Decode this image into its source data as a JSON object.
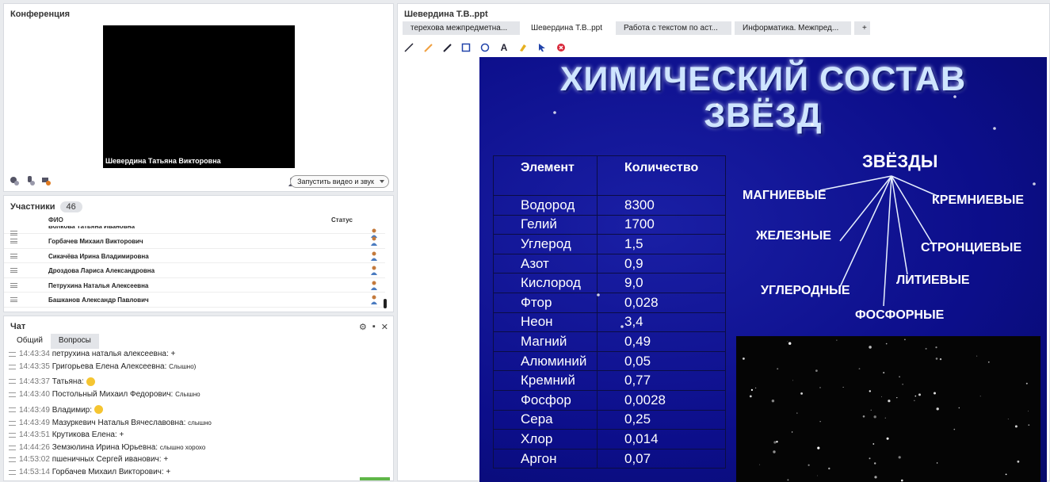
{
  "conference": {
    "title": "Конференция",
    "video_name": "Шевердина Татьяна Викторовна",
    "start_video_label": "Запустить видео и звук"
  },
  "participants": {
    "title": "Участники",
    "count": "46",
    "col_name": "ФИО",
    "col_status": "Статус",
    "rows": [
      "Волкова Татьяна Ивановна",
      "Горбачев Михаил  Викторович",
      "Сикачёва Ирина  Владимировна",
      "Дроздова Лариса  Александровна",
      "Петрухина  Наталья  Алексеевна",
      "Башканов Александр Павлович"
    ]
  },
  "chat": {
    "title": "Чат",
    "tabs": [
      "Общий",
      "Вопросы"
    ],
    "messages": [
      {
        "time": "14:43:34",
        "author": "петрухина  наталья алексеевна:",
        "text": "+",
        "small": false
      },
      {
        "time": "14:43:35",
        "author": "Григорьева Елена  Алексеевна:",
        "text": "Слышно)",
        "small": true
      },
      {
        "time": "14:43:37",
        "author": "Татьяна:",
        "text": "",
        "emoji": true
      },
      {
        "time": "14:43:40",
        "author": "Постольный Михаил  Федорович:",
        "text": "Слышно",
        "small": true
      },
      {
        "time": "14:43:49",
        "author": "Владимир:",
        "text": "",
        "emoji": true
      },
      {
        "time": "14:43:49",
        "author": "Мазуркевич Наталья  Вячеславовна:",
        "text": "слышно",
        "small": true
      },
      {
        "time": "14:43:51",
        "author": "Крутикова Елена:",
        "text": "+",
        "small": false
      },
      {
        "time": "14:44:26",
        "author": "Земзюлина  Ирина   Юрьевна:",
        "text": "слышно хорохо",
        "small": true
      },
      {
        "time": "14:53:02",
        "author": "пшеничных  Сергей иванович:",
        "text": "+",
        "small": false
      },
      {
        "time": "14:53:14",
        "author": "Горбачев Михаил  Викторович:",
        "text": "+",
        "small": false
      }
    ]
  },
  "presentation": {
    "title": "Шевердина Т.В..ppt",
    "tabs": [
      "терехова межпредметна...",
      "Шевердина Т.В..ppt",
      "Работа с текстом по аст...",
      "Информатика. Межпред...",
      "+"
    ],
    "active_tab": 1,
    "tools": [
      "line-tool",
      "highlighter-tool",
      "pen-tool",
      "rectangle-tool",
      "circle-tool",
      "text-tool",
      "eraser-tool",
      "pointer-tool",
      "clear-tool"
    ],
    "slide": {
      "title_line1": "ХИМИЧЕСКИЙ СОСТАВ",
      "title_line2": "ЗВЁЗД",
      "table_headers": [
        "Элемент",
        "Количество"
      ],
      "table_rows": [
        [
          "Водород",
          "8300"
        ],
        [
          "Гелий",
          "1700"
        ],
        [
          "Углерод",
          "1,5"
        ],
        [
          "Азот",
          "0,9"
        ],
        [
          "Кислород",
          "9,0"
        ],
        [
          "Фтор",
          "0,028"
        ],
        [
          "Неон",
          "3,4"
        ],
        [
          "Магний",
          "0,49"
        ],
        [
          "Алюминий",
          "0,05"
        ],
        [
          "Кремний",
          "0,77"
        ],
        [
          "Фосфор",
          "0,0028"
        ],
        [
          "Сера",
          "0,25"
        ],
        [
          "Хлор",
          "0,014"
        ],
        [
          "Аргон",
          "0,07"
        ]
      ],
      "stars_heading": "ЗВЁЗДЫ",
      "star_types": [
        "МАГНИЕВЫЕ",
        "КРЕМНИЕВЫЕ",
        "ЖЕЛЕЗНЫЕ",
        "СТРОНЦИЕВЫЕ",
        "ЛИТИЕВЫЕ",
        "УГЛЕРОДНЫЕ",
        "ФОСФОРНЫЕ"
      ]
    }
  }
}
